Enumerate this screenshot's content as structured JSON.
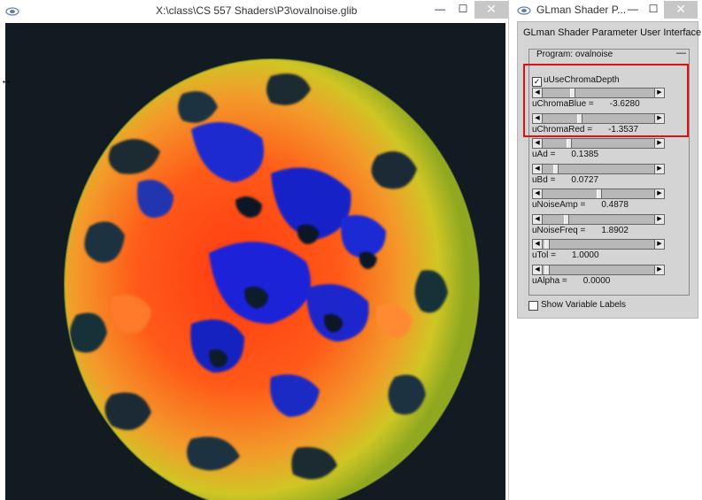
{
  "main_window": {
    "title": "X:\\class\\CS 557 Shaders\\P3\\ovalnoise.glib",
    "buttons": {
      "minimize": "—",
      "maximize": "☐",
      "close": "✕"
    }
  },
  "panel_window": {
    "title": "GLman Shader P...",
    "buttons": {
      "minimize": "—",
      "maximize": "☐",
      "close": "✕"
    },
    "heading": "GLman Shader Parameter User Interface",
    "program_label": "Program: ovalnoise",
    "collapse": "—",
    "use_chroma_depth": {
      "label": "uUseChromaDepth",
      "checked": true,
      "check_glyph": "✓"
    },
    "sliders": [
      {
        "name": "uChromaBlue",
        "label": "uChromaBlue =",
        "value": "-3.6280",
        "position": 0.25
      },
      {
        "name": "uChromaRed",
        "label": "uChromaRed =",
        "value": "-1.3537",
        "position": 0.32
      },
      {
        "name": "uAd",
        "label": "uAd =",
        "value": "0.1385",
        "position": 0.22
      },
      {
        "name": "uBd",
        "label": "uBd =",
        "value": "0.0727",
        "position": 0.1
      },
      {
        "name": "uNoiseAmp",
        "label": "uNoiseAmp =",
        "value": "0.4878",
        "position": 0.5
      },
      {
        "name": "uNoiseFreq",
        "label": "uNoiseFreq =",
        "value": "1.8902",
        "position": 0.2
      },
      {
        "name": "uTol",
        "label": "uTol =",
        "value": "1.0000",
        "position": 0.02
      },
      {
        "name": "uAlpha",
        "label": "uAlpha =",
        "value": "0.0000",
        "position": 0.02
      }
    ],
    "show_variable_labels": {
      "label": "Show Variable Labels",
      "checked": false
    }
  },
  "colors": {
    "viewport_background": "#121b22",
    "highlight": "#e01010",
    "noise_core": "#ff3a12",
    "noise_outer": "#c9d21a",
    "noise_deep": "#1820d8"
  }
}
